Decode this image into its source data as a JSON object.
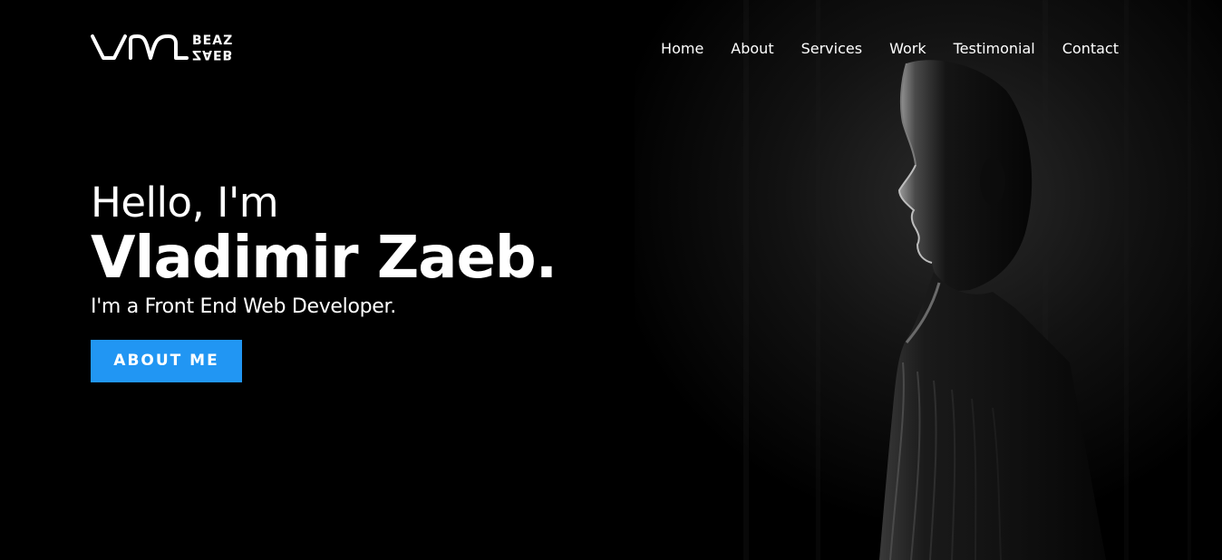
{
  "logo": {
    "monogram": "VM",
    "line_top": "BEAZ",
    "line_bottom": "ZAEB",
    "icon": "vm-monogram-logo"
  },
  "nav": {
    "items": [
      {
        "label": "Home"
      },
      {
        "label": "About"
      },
      {
        "label": "Services"
      },
      {
        "label": "Work"
      },
      {
        "label": "Testimonial"
      },
      {
        "label": "Contact"
      }
    ]
  },
  "hero": {
    "greeting": "Hello, I'm",
    "name": "Vladimir Zaeb.",
    "role": "I'm a Front End Web Developer.",
    "cta_label": "ABOUT ME",
    "background_image": "man-profile-silhouette"
  },
  "colors": {
    "background": "#000000",
    "text": "#ffffff",
    "accent": "#2196f3"
  }
}
